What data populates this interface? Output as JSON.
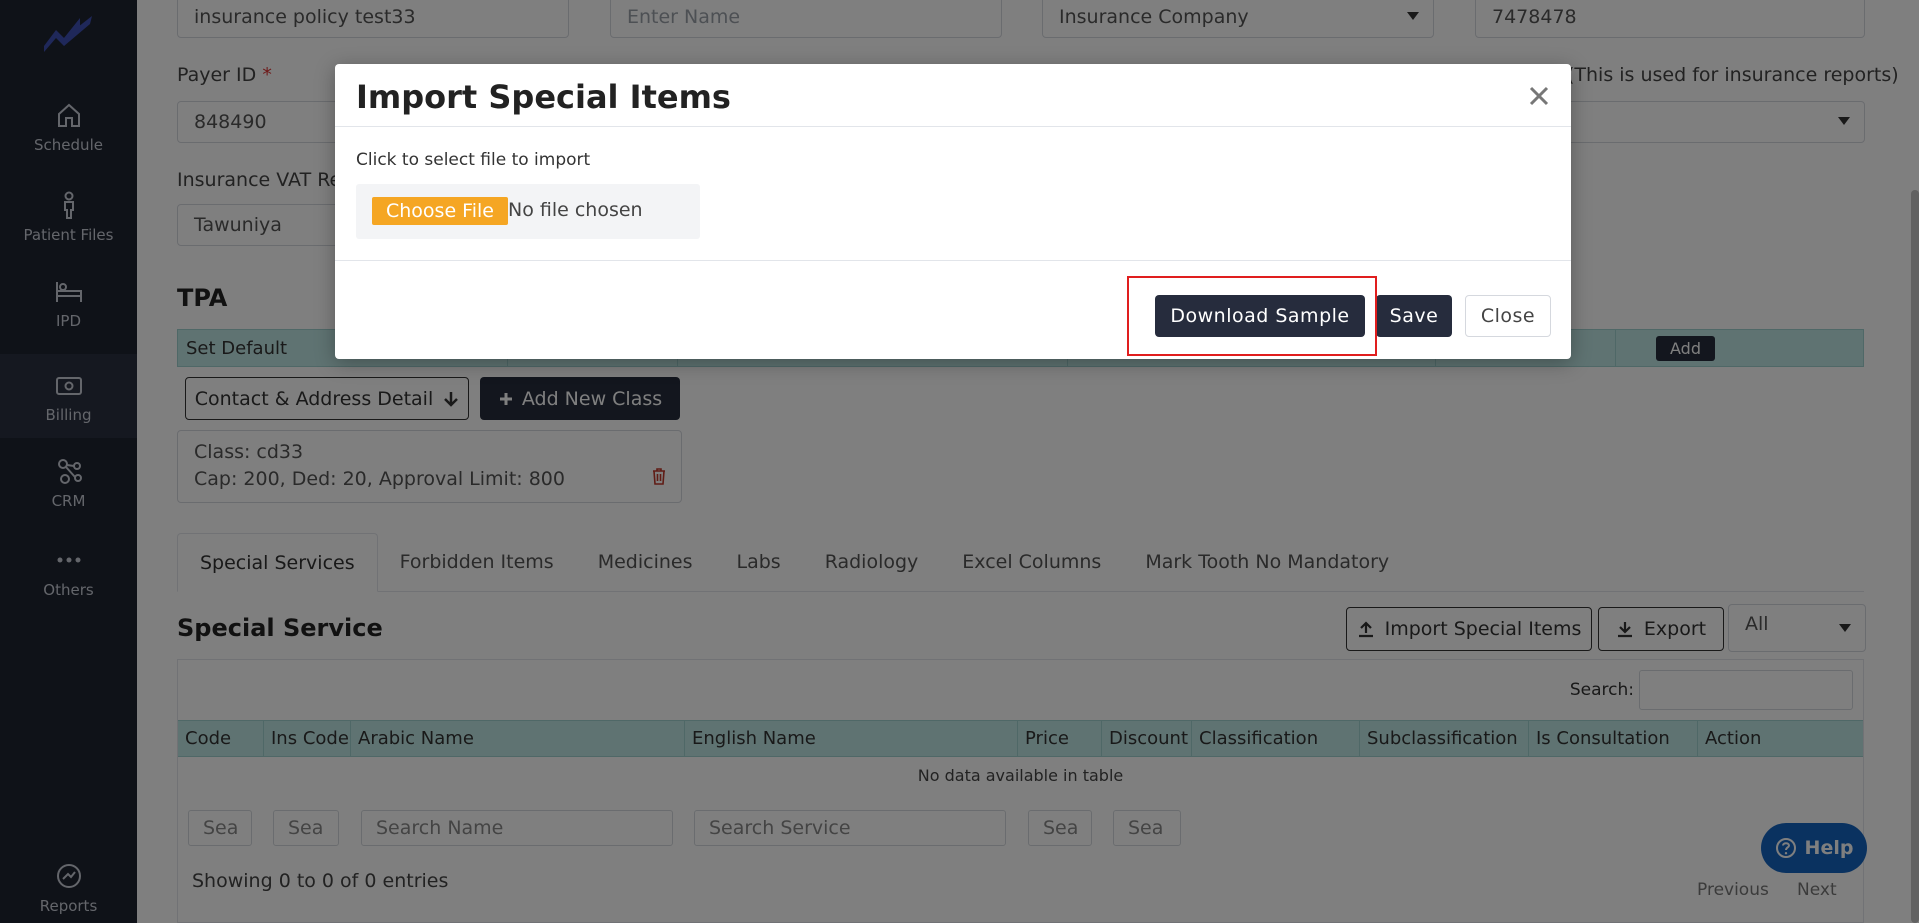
{
  "sidebar": {
    "items": [
      {
        "label": "Schedule",
        "icon": "home-icon"
      },
      {
        "label": "Patient Files",
        "icon": "person-icon"
      },
      {
        "label": "IPD",
        "icon": "bed-icon"
      },
      {
        "label": "Billing",
        "icon": "money-icon"
      },
      {
        "label": "CRM",
        "icon": "network-icon"
      },
      {
        "label": "Others",
        "icon": "dots-icon"
      },
      {
        "label": "Reports",
        "icon": "chart-icon"
      }
    ]
  },
  "form": {
    "name_value": "insurance policy test33",
    "enter_name_placeholder": "Enter Name",
    "company_value": "Insurance Company",
    "number_value": "7478478",
    "payer_label": "Payer ID",
    "payer_required": "*",
    "payer_value": "848490",
    "report_hint": "(This is used for insurance reports)",
    "vat_label": "Insurance VAT Rep",
    "vat_value": "Tawuniya"
  },
  "tpa": {
    "heading": "TPA",
    "set_default": "Set Default",
    "add_label": "Add",
    "contact_button": "Contact & Address Detail",
    "add_class_button": "Add New Class",
    "class_line1": "Class: cd33",
    "class_line2": "Cap: 200, Ded: 20, Approval Limit: 800"
  },
  "tabs": [
    "Special Services",
    "Forbidden Items",
    "Medicines",
    "Labs",
    "Radiology",
    "Excel Columns",
    "Mark Tooth No Mandatory"
  ],
  "special_service": {
    "heading": "Special Service",
    "import_button": "Import Special Items",
    "export_button": "Export",
    "filter_value": "All",
    "search_label": "Search:",
    "columns": [
      "Code",
      "Ins Code",
      "Arabic Name",
      "English Name",
      "Price",
      "Discount",
      "Classification",
      "Subclassification",
      "Is Consultation",
      "Action"
    ],
    "no_data": "No data available in table",
    "filter_placeholders": [
      "Sea",
      "Sea",
      "Search Name",
      "Search Service",
      "Sea",
      "Sea"
    ],
    "showing": "Showing 0 to 0 of 0 entries",
    "previous": "Previous",
    "next": "Next"
  },
  "help": {
    "label": "Help"
  },
  "modal": {
    "title": "Import Special Items",
    "file_prompt": "Click to select file to import",
    "choose_file": "Choose File",
    "no_file": "No file chosen",
    "download_sample": "Download Sample",
    "save": "Save",
    "close": "Close"
  },
  "colors": {
    "sidebar": "#1f2431",
    "primary_dark": "#262c3d",
    "table_header": "#bfe7e5",
    "choose_file": "#f5a623",
    "help": "#1565c0",
    "highlight": "#e01e1e"
  }
}
